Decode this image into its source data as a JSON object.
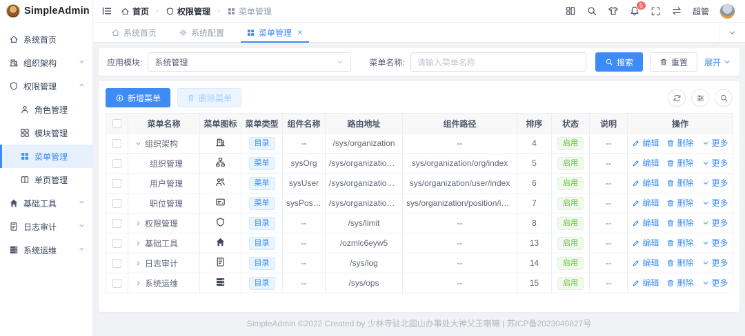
{
  "app": {
    "name": "SimpleAdmin"
  },
  "colors": {
    "primary": "#3d8bf5",
    "success": "#67c23a",
    "danger": "#f56c6c",
    "page_bg": "#f0f2f5",
    "badge_blue_bg": "#e8f4ff",
    "badge_green_bg": "#f0f9eb"
  },
  "sidebar": {
    "items": [
      {
        "label": "系统首页",
        "icon": "home"
      },
      {
        "label": "组织架构",
        "icon": "building",
        "chevron": "down"
      },
      {
        "label": "权限管理",
        "icon": "shield",
        "chevron": "up"
      },
      {
        "label": "角色管理",
        "icon": "user",
        "child": true
      },
      {
        "label": "模块管理",
        "icon": "modules",
        "child": true
      },
      {
        "label": "菜单管理",
        "icon": "menu-grid",
        "child": true,
        "active": true
      },
      {
        "label": "单页管理",
        "icon": "book",
        "child": true
      },
      {
        "label": "基础工具",
        "icon": "house",
        "chevron": "down"
      },
      {
        "label": "日志审计",
        "icon": "log",
        "chevron": "down"
      },
      {
        "label": "系统运维",
        "icon": "server",
        "chevron": "down"
      }
    ]
  },
  "topbar": {
    "breadcrumb": [
      {
        "label": "首页",
        "icon": "home"
      },
      {
        "label": "权限管理",
        "icon": "shield"
      },
      {
        "label": "菜单管理",
        "icon": "menu-grid",
        "muted": true
      }
    ],
    "username": "超管",
    "notification_count": "5"
  },
  "tabs": [
    {
      "label": "系统首页",
      "icon": "home"
    },
    {
      "label": "系统配置",
      "icon": "gear"
    },
    {
      "label": "菜单管理",
      "icon": "menu-grid",
      "active": true,
      "closable": true
    }
  ],
  "filter": {
    "module_label": "应用模块:",
    "module_value": "系统管理",
    "name_label": "菜单名称:",
    "name_placeholder": "请输入菜单名称",
    "search_label": "搜索",
    "reset_label": "重置",
    "expand_label": "展开"
  },
  "toolbar": {
    "add_label": "新增菜单",
    "delete_label": "删除菜单"
  },
  "table": {
    "headers": [
      "菜单名称",
      "菜单图标",
      "菜单类型",
      "组件名称",
      "路由地址",
      "组件路径",
      "排序",
      "状态",
      "说明",
      "操作"
    ],
    "actions": {
      "edit": "编辑",
      "delete": "删除",
      "more": "更多"
    },
    "rows": [
      {
        "name": "组织架构",
        "expand": "down",
        "child": false,
        "icon": "building",
        "type": "目录",
        "component_name": "--",
        "route": "/sys/organization",
        "component_path": "--",
        "sort": "4",
        "status": "启用",
        "description": "--"
      },
      {
        "name": "组织管理",
        "expand": "",
        "child": true,
        "icon": "org",
        "type": "菜单",
        "component_name": "sysOrg",
        "route": "/sys/organization/org",
        "component_path": "sys/organization/org/index",
        "sort": "5",
        "status": "启用",
        "description": "--"
      },
      {
        "name": "用户管理",
        "expand": "",
        "child": true,
        "icon": "users",
        "type": "菜单",
        "component_name": "sysUser",
        "route": "/sys/organization/user",
        "component_path": "sys/organization/user/index",
        "sort": "6",
        "status": "启用",
        "description": "--"
      },
      {
        "name": "职位管理",
        "expand": "",
        "child": true,
        "icon": "idcard",
        "type": "菜单",
        "component_name": "sysPosi...",
        "route": "/sys/organization/positi...",
        "component_path": "sys/organization/position/index",
        "sort": "7",
        "status": "启用",
        "description": "--"
      },
      {
        "name": "权限管理",
        "expand": "right",
        "child": false,
        "icon": "shield",
        "type": "目录",
        "component_name": "--",
        "route": "/sys/limit",
        "component_path": "--",
        "sort": "8",
        "status": "启用",
        "description": "--"
      },
      {
        "name": "基础工具",
        "expand": "right",
        "child": false,
        "icon": "house",
        "type": "目录",
        "component_name": "--",
        "route": "/ozmlc6eyw5",
        "component_path": "--",
        "sort": "13",
        "status": "启用",
        "description": "--"
      },
      {
        "name": "日志审计",
        "expand": "right",
        "child": false,
        "icon": "log",
        "type": "目录",
        "component_name": "--",
        "route": "/sys/log",
        "component_path": "--",
        "sort": "14",
        "status": "启用",
        "description": "--"
      },
      {
        "name": "系统运维",
        "expand": "right",
        "child": false,
        "icon": "server",
        "type": "目录",
        "component_name": "--",
        "route": "/sys/ops",
        "component_path": "--",
        "sort": "15",
        "status": "启用",
        "description": "--"
      }
    ]
  },
  "footer": {
    "text": "SimpleAdmin ©2022 Created by 少林寺驻北固山办事处大神父王喇嘛 | 苏ICP备2023040827号"
  }
}
